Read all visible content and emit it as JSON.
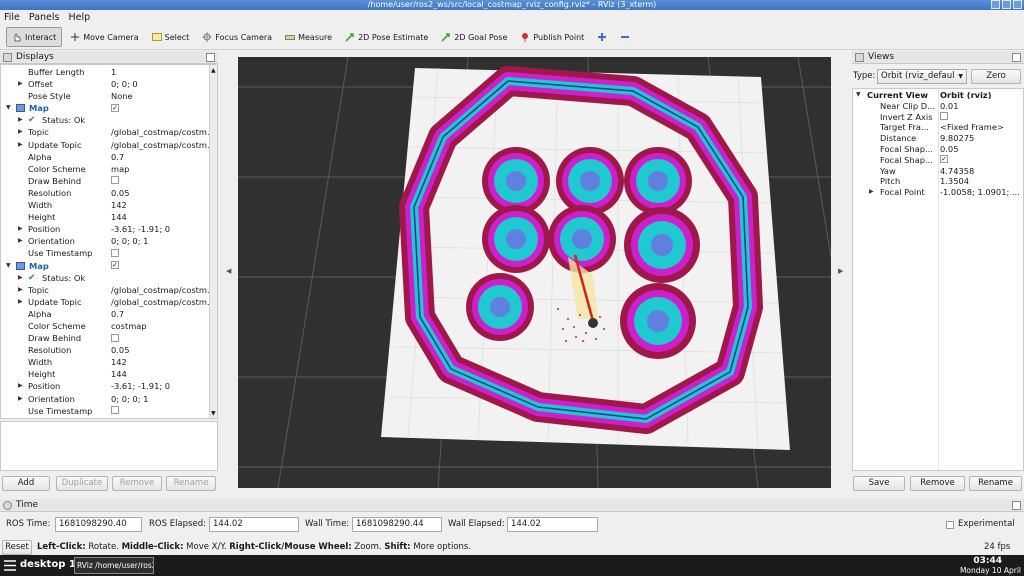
{
  "window": {
    "title": "/home/user/ros2_ws/src/local_costmap_rviz_config.rviz* - RViz (3_xterm)"
  },
  "menu": [
    "File",
    "Panels",
    "Help"
  ],
  "toolbar": {
    "interact": "Interact",
    "move_camera": "Move Camera",
    "select": "Select",
    "focus_camera": "Focus Camera",
    "measure": "Measure",
    "pose_estimate": "2D Pose Estimate",
    "goal_pose": "2D Goal Pose",
    "publish_point": "Publish Point"
  },
  "displays": {
    "title": "Displays",
    "rows": [
      {
        "k": "Buffer Length",
        "v": "1"
      },
      {
        "k": "Offset",
        "v": "0; 0; 0"
      },
      {
        "k": "Pose Style",
        "v": "None"
      },
      {
        "k": "Map",
        "v": ""
      },
      {
        "k": "Status: Ok",
        "v": ""
      },
      {
        "k": "Topic",
        "v": "/global_costmap/costm..."
      },
      {
        "k": "Update Topic",
        "v": "/global_costmap/costm..."
      },
      {
        "k": "Alpha",
        "v": "0.7"
      },
      {
        "k": "Color Scheme",
        "v": "map"
      },
      {
        "k": "Draw Behind",
        "v": ""
      },
      {
        "k": "Resolution",
        "v": "0.05"
      },
      {
        "k": "Width",
        "v": "142"
      },
      {
        "k": "Height",
        "v": "144"
      },
      {
        "k": "Position",
        "v": "-3.61; -1.91; 0"
      },
      {
        "k": "Orientation",
        "v": "0; 0; 0; 1"
      },
      {
        "k": "Use Timestamp",
        "v": ""
      },
      {
        "k": "Map",
        "v": ""
      },
      {
        "k": "Status: Ok",
        "v": ""
      },
      {
        "k": "Topic",
        "v": "/global_costmap/costm..."
      },
      {
        "k": "Update Topic",
        "v": "/global_costmap/costm..."
      },
      {
        "k": "Alpha",
        "v": "0.7"
      },
      {
        "k": "Color Scheme",
        "v": "costmap"
      },
      {
        "k": "Draw Behind",
        "v": ""
      },
      {
        "k": "Resolution",
        "v": "0.05"
      },
      {
        "k": "Width",
        "v": "142"
      },
      {
        "k": "Height",
        "v": "144"
      },
      {
        "k": "Position",
        "v": "-3.61; -1.91; 0"
      },
      {
        "k": "Orientation",
        "v": "0; 0; 0; 1"
      },
      {
        "k": "Use Timestamp",
        "v": ""
      }
    ],
    "buttons": {
      "add": "Add",
      "duplicate": "Duplicate",
      "remove": "Remove",
      "rename": "Rename"
    }
  },
  "views": {
    "title": "Views",
    "type_label": "Type:",
    "type_value": "Orbit (rviz_defaul",
    "zero": "Zero",
    "rows": [
      {
        "k": "Current View",
        "v": "Orbit (rviz)"
      },
      {
        "k": "Near Clip D...",
        "v": "0.01"
      },
      {
        "k": "Invert Z Axis",
        "v": ""
      },
      {
        "k": "Target Fra...",
        "v": "<Fixed Frame>"
      },
      {
        "k": "Distance",
        "v": "9.80275"
      },
      {
        "k": "Focal Shap...",
        "v": "0.05"
      },
      {
        "k": "Focal Shap...",
        "v": ""
      },
      {
        "k": "Yaw",
        "v": "4.74358"
      },
      {
        "k": "Pitch",
        "v": "1.3504"
      },
      {
        "k": "Focal Point",
        "v": "-1.0058; 1.0901; ..."
      }
    ],
    "buttons": {
      "save": "Save",
      "remove": "Remove",
      "rename": "Rename"
    }
  },
  "time": {
    "title": "Time",
    "ros_time_label": "ROS Time:",
    "ros_time": "1681098290.40",
    "ros_elapsed_label": "ROS Elapsed:",
    "ros_elapsed": "144.02",
    "wall_time_label": "Wall Time:",
    "wall_time": "1681098290.44",
    "wall_elapsed_label": "Wall Elapsed:",
    "wall_elapsed": "144.02",
    "experimental": "Experimental"
  },
  "status": {
    "reset": "Reset",
    "hint_b1": "Left-Click:",
    "hint_t1": " Rotate. ",
    "hint_b2": "Middle-Click:",
    "hint_t2": " Move X/Y. ",
    "hint_b3": "Right-Click/Mouse Wheel:",
    "hint_t3": " Zoom. ",
    "hint_b4": "Shift:",
    "hint_t4": " More options.",
    "fps": "24 fps"
  },
  "taskbar": {
    "desktop": "desktop 1",
    "task": "RViz /home/user/ros2_...",
    "time": "03:44",
    "date": "Monday 10 April"
  }
}
